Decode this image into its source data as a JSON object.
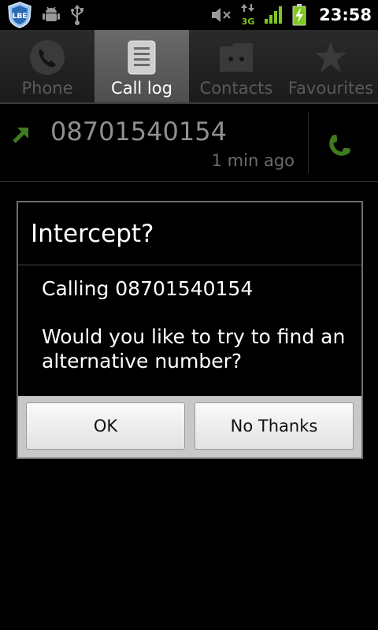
{
  "statusbar": {
    "icons_left": [
      "lbe-shield-icon",
      "android-debug-icon",
      "usb-icon"
    ],
    "lbe_text": "LBE",
    "icons_right": [
      "volume-muted-icon",
      "3g-data-icon",
      "signal-strength-icon",
      "battery-charging-icon"
    ],
    "network_label": "3G",
    "time": "23:58"
  },
  "tabs": [
    {
      "label": "Phone",
      "icon": "phone-icon",
      "selected": false
    },
    {
      "label": "Call log",
      "icon": "call-log-icon",
      "selected": true
    },
    {
      "label": "Contacts",
      "icon": "contacts-icon",
      "selected": false
    },
    {
      "label": "Favourites",
      "icon": "star-icon",
      "selected": false
    }
  ],
  "call_log": {
    "entries": [
      {
        "number": "08701540154",
        "time_ago": "1 min ago",
        "type_icon": "outgoing-call-arrow-icon"
      }
    ]
  },
  "dialog": {
    "title": "Intercept?",
    "message_line1": "Calling 08701540154",
    "message_line2": "Would you like to try to find an alternative number?",
    "ok_label": "OK",
    "no_label": "No Thanks"
  },
  "colors": {
    "accent_green": "#7ec820",
    "dim_green": "#3f7a1f",
    "tab_selected": "#5a5a5a"
  }
}
